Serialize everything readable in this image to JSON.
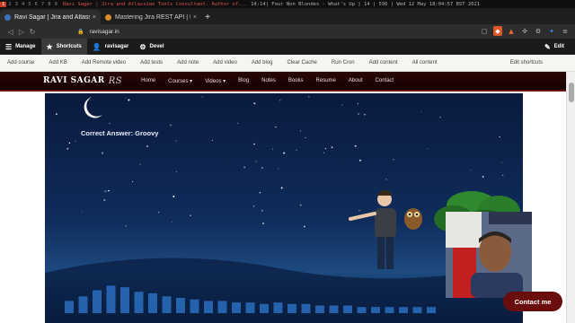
{
  "wm": {
    "workspaces": [
      "1",
      "2",
      "3",
      "4",
      "5",
      "6",
      "7",
      "8",
      "9"
    ],
    "active_workspace": "1",
    "window_title": "Ravi Sagar | Jira and Atlassian Tools Consultant. Author of...",
    "status": "14:14| Four Non Blondes - What's Up | 14 | 596 | Wed 12 May 18:04:57 BST 2021"
  },
  "browser": {
    "tabs": [
      {
        "label": "Ravi Sagar | Jira and Atlassi",
        "active": true,
        "favicon": "ravisagar-favicon"
      },
      {
        "label": "Mastering Jira REST API | R",
        "active": false,
        "favicon": "udemy-favicon"
      }
    ],
    "new_tab": "+",
    "url": "ravisagar.in",
    "close_glyph": "×"
  },
  "admin_toolbar": {
    "manage": "Manage",
    "shortcuts": "Shortcuts",
    "user": "ravisagar",
    "devel": "Devel",
    "edit": "Edit"
  },
  "shortcuts": {
    "items": [
      "Add course",
      "Add KB",
      "Add Remote video",
      "Add tests",
      "Add note",
      "Add video",
      "Add blog",
      "Clear Cache",
      "Run Cron",
      "Add content",
      "All content"
    ],
    "edit_label": "Edit shortcuts"
  },
  "site": {
    "logo": "RAVI SAGAR",
    "logo_mark": "RS",
    "nav": [
      "Home",
      "Courses ▾",
      "Videos ▾",
      "Blog",
      "Notes",
      "Books",
      "Resume",
      "About",
      "Contact"
    ]
  },
  "video": {
    "answer_text": "Correct Answer: Groovy",
    "audio_levels": [
      0.4,
      0.55,
      0.75,
      0.9,
      0.85,
      0.7,
      0.65,
      0.55,
      0.5,
      0.45,
      0.4,
      0.4,
      0.35,
      0.35,
      0.3,
      0.35,
      0.3,
      0.3,
      0.25,
      0.25,
      0.25,
      0.2,
      0.2,
      0.2,
      0.2,
      0.2,
      0.2
    ]
  },
  "contact_button": "Contact me",
  "colors": {
    "accent": "#6a0d0d",
    "wm_active": "#c23b22",
    "video_sky": "#0f2c5a"
  }
}
